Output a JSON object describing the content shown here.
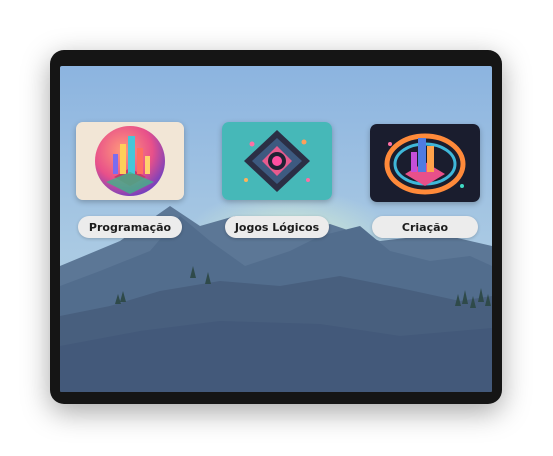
{
  "cards": [
    {
      "label": "Programação",
      "icon": "isometric-city-circle-icon"
    },
    {
      "label": "Jogos Lógicos",
      "icon": "isometric-puzzle-diamond-icon"
    },
    {
      "label": "Criação",
      "icon": "isometric-neon-structure-icon"
    }
  ],
  "colors": {
    "sky_top": "#8fb8e2",
    "mountain": "#4f6a8a",
    "foreground": "#445c7a",
    "label_bg": "#ececec",
    "device_frame": "#151515"
  }
}
